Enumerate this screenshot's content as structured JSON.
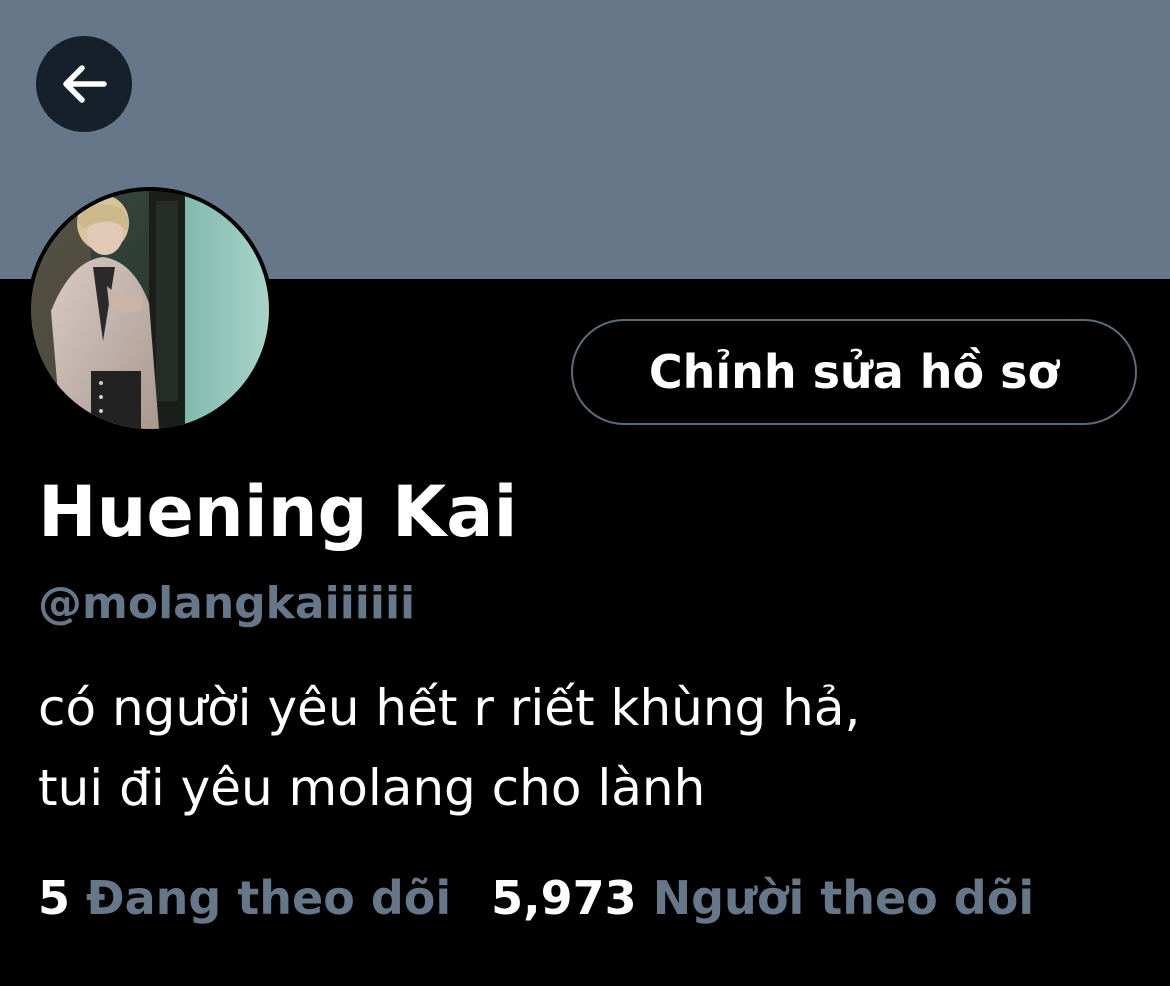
{
  "header": {
    "back_icon": "arrow-left-icon",
    "banner_color": "#66778a"
  },
  "profile": {
    "edit_button_label": "Chỉnh sửa hồ sơ",
    "display_name": "Huening Kai",
    "handle": "@molangkaiiiiii",
    "bio_lines": [
      "có người yêu hết r riết khùng hả,",
      "tui đi yêu molang cho lành"
    ]
  },
  "stats": {
    "following_count": "5",
    "following_label": "Đang theo dõi",
    "followers_count": "5,973",
    "followers_label": "Người theo dõi"
  },
  "colors": {
    "background": "#000000",
    "muted_text": "#66778a",
    "primary_text": "#ffffff",
    "button_border": "#5b6b7a"
  }
}
